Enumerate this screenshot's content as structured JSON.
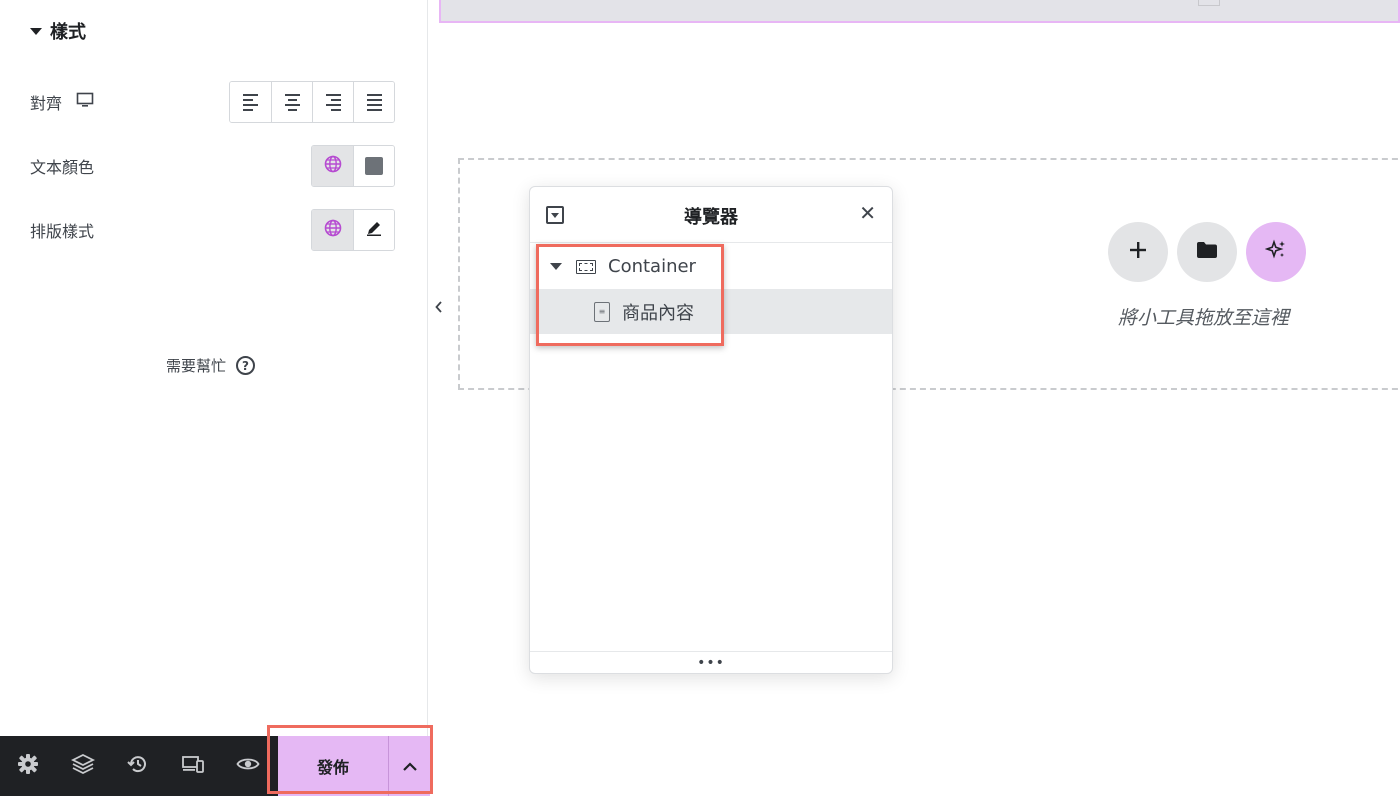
{
  "panel": {
    "section_title": "樣式",
    "controls": [
      {
        "label": "對齊",
        "icon": "desktop-icon"
      },
      {
        "label": "文本顏色",
        "icon": "globe-icon"
      },
      {
        "label": "排版樣式",
        "icon": "pencil-icon"
      }
    ],
    "help_label": "需要幫忙",
    "help_icon": "?"
  },
  "bottombar": {
    "publish_label": "發佈",
    "icons": [
      "settings-icon",
      "layers-icon",
      "history-icon",
      "responsive-icon",
      "preview-icon"
    ]
  },
  "canvas": {
    "dropzone_text": "將小工具拖放至這裡"
  },
  "navigator": {
    "title": "導覽器",
    "close": "✕",
    "items": [
      {
        "label": "Container",
        "type": "container"
      },
      {
        "label": "商品內容",
        "type": "widget"
      }
    ],
    "footer": "•••"
  },
  "colors": {
    "accent": "#e5b8f4",
    "globe": "#b64bd1",
    "highlight": "#ef6b5e",
    "dark": "#1f2124"
  }
}
